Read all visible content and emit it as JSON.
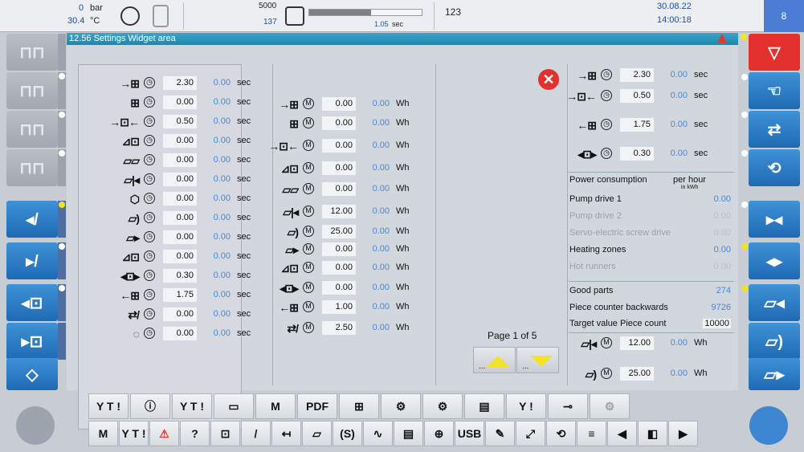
{
  "topbar": {
    "pressure_value": "0",
    "pressure_unit": "bar",
    "temp_value": "30.4",
    "temp_unit": "°C",
    "counter_top": "5000",
    "counter_bottom": "137",
    "progress_time": "1.05",
    "progress_unit": "sec",
    "progress_fraction": 0.55,
    "shot_count": "123",
    "date": "30.08.22",
    "time": "14:00:18",
    "page_number": "8"
  },
  "title": "12.56 Settings Widget area",
  "column_a": [
    {
      "icon": "→⊞",
      "unit_icon": "clock",
      "value": "2.30",
      "actual": "0.00",
      "unit": "sec"
    },
    {
      "icon": "⊞",
      "unit_icon": "clock",
      "value": "0.00",
      "actual": "0.00",
      "unit": "sec"
    },
    {
      "icon": "→⊡←",
      "unit_icon": "clock",
      "value": "0.50",
      "actual": "0.00",
      "unit": "sec"
    },
    {
      "icon": "⊿⊡",
      "unit_icon": "clock",
      "value": "0.00",
      "actual": "0.00",
      "unit": "sec"
    },
    {
      "icon": "▱▱",
      "unit_icon": "clock",
      "value": "0.00",
      "actual": "0.00",
      "unit": "sec"
    },
    {
      "icon": "▱|◂",
      "unit_icon": "clock",
      "value": "0.00",
      "actual": "0.00",
      "unit": "sec"
    },
    {
      "icon": "⬡",
      "unit_icon": "clock",
      "value": "0.00",
      "actual": "0.00",
      "unit": "sec"
    },
    {
      "icon": "▱)",
      "unit_icon": "clock",
      "value": "0.00",
      "actual": "0.00",
      "unit": "sec"
    },
    {
      "icon": "▱▸",
      "unit_icon": "clock",
      "value": "0.00",
      "actual": "0.00",
      "unit": "sec"
    },
    {
      "icon": "⊿⊡",
      "unit_icon": "clock",
      "value": "0.00",
      "actual": "0.00",
      "unit": "sec"
    },
    {
      "icon": "◂⊡▸",
      "unit_icon": "clock",
      "value": "0.30",
      "actual": "0.00",
      "unit": "sec"
    },
    {
      "icon": "←⊞",
      "unit_icon": "clock",
      "value": "1.75",
      "actual": "0.00",
      "unit": "sec"
    },
    {
      "icon": "⇄/",
      "unit_icon": "clock",
      "value": "0.00",
      "actual": "0.00",
      "unit": "sec"
    },
    {
      "icon": "◌",
      "unit_icon": "clock",
      "value": "0.00",
      "actual": "0.00",
      "unit": "sec"
    }
  ],
  "column_b": [
    {
      "icon": "→⊞",
      "unit_icon": "M",
      "value": "0.00",
      "actual": "0.00",
      "unit": "Wh"
    },
    {
      "icon": "⊞",
      "unit_icon": "M",
      "value": "0.00",
      "actual": "0.00",
      "unit": "Wh"
    },
    {
      "icon": "→⊡←",
      "unit_icon": "M",
      "value": "0.00",
      "actual": "0.00",
      "unit": "Wh"
    },
    {
      "icon": "⊿⊡",
      "unit_icon": "M",
      "value": "0.00",
      "actual": "0.00",
      "unit": "Wh"
    },
    {
      "icon": "▱▱",
      "unit_icon": "M",
      "value": "0.00",
      "actual": "0.00",
      "unit": "Wh"
    },
    {
      "icon": "▱|◂",
      "unit_icon": "M",
      "value": "12.00",
      "actual": "0.00",
      "unit": "Wh"
    },
    {
      "icon": "▱)",
      "unit_icon": "M",
      "value": "25.00",
      "actual": "0.00",
      "unit": "Wh"
    },
    {
      "icon": "▱▸",
      "unit_icon": "M",
      "value": "0.00",
      "actual": "0.00",
      "unit": "Wh"
    },
    {
      "icon": "⊿⊡",
      "unit_icon": "M",
      "value": "0.00",
      "actual": "0.00",
      "unit": "Wh"
    },
    {
      "icon": "◂⊡▸",
      "unit_icon": "M",
      "value": "0.00",
      "actual": "0.00",
      "unit": "Wh"
    },
    {
      "icon": "←⊞",
      "unit_icon": "M",
      "value": "1.00",
      "actual": "0.00",
      "unit": "Wh"
    },
    {
      "icon": "⇄/",
      "unit_icon": "M",
      "value": "2.50",
      "actual": "0.00",
      "unit": "Wh"
    }
  ],
  "column_r": [
    {
      "icon": "→⊞",
      "unit_icon": "clock",
      "value": "2.30",
      "actual": "0.00",
      "unit": "sec"
    },
    {
      "icon": "→⊡←",
      "unit_icon": "clock",
      "value": "0.50",
      "actual": "0.00",
      "unit": "sec"
    },
    {
      "icon": "←⊞",
      "unit_icon": "clock",
      "value": "1.75",
      "actual": "0.00",
      "unit": "sec"
    },
    {
      "icon": "◂⊡▸",
      "unit_icon": "clock",
      "value": "0.30",
      "actual": "0.00",
      "unit": "sec"
    }
  ],
  "power": {
    "title": "Power consumption",
    "per_hour": "per hour",
    "per_hour_unit": "in kWh",
    "rows": [
      {
        "label": "Pump drive 1",
        "value": "0.00",
        "dim": false
      },
      {
        "label": "Pump drive 2",
        "value": "0.00",
        "dim": true
      },
      {
        "label": "Servo-electric screw drive",
        "value": "0.00",
        "dim": true
      },
      {
        "label": "Heating zones",
        "value": "0.00",
        "dim": false
      },
      {
        "label": "Hot runners",
        "value": "0.00",
        "dim": true
      }
    ]
  },
  "counts": {
    "good_parts_label": "Good parts",
    "good_parts_value": "274",
    "piece_counter_label": "Piece counter backwards",
    "piece_counter_value": "9726",
    "target_label": "Target value Piece count",
    "target_value": "10000"
  },
  "bottom_r": [
    {
      "icon": "▱|◂",
      "unit_icon": "M",
      "value": "12.00",
      "actual": "0.00",
      "unit": "Wh"
    },
    {
      "icon": "▱)",
      "unit_icon": "M",
      "value": "25.00",
      "actual": "0.00",
      "unit": "Wh"
    }
  ],
  "pager": {
    "label": "Page 1 of 5",
    "dots": "..."
  },
  "toolbar_upper": [
    "Y T !",
    "ⓘ",
    "Y T !",
    "▭",
    "M",
    "PDF",
    "⊞",
    "⚙",
    "⚙",
    "▤",
    "Y !",
    "⊸",
    "⚙"
  ],
  "toolbar_lower": [
    "M",
    "Y T !",
    "⚠",
    "?",
    "⊡",
    "/",
    "↤",
    "▱",
    "(S)",
    "∿",
    "▤",
    "⊕",
    "USB",
    "✎",
    "⤢",
    "⟲",
    "≡",
    "◀",
    "◧",
    "▶"
  ],
  "colors": {
    "accent_blue": "#1e6ab4",
    "value_blue": "#4a86d8",
    "alert_red": "#e3322d",
    "status_yellow": "#f3e21e"
  }
}
